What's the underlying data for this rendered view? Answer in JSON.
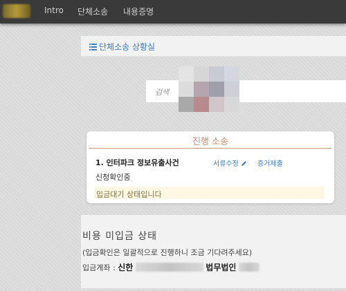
{
  "nav": {
    "items": [
      "Intro",
      "단체소송",
      "내용증명"
    ]
  },
  "header": {
    "link_label": "단체소송 상황실"
  },
  "search": {
    "label": "검색"
  },
  "mosaic_colors": [
    "#e4e4e4",
    "#d6d6d6",
    "#c9cbd2",
    "#d5d7de",
    "#dcdcdc",
    "#b5a5ad",
    "#9f9fac",
    "#cfcfd6",
    "#a9a9a9",
    "#b98a8d",
    "#cfc6c9",
    "#d8d8d8"
  ],
  "case_card": {
    "title": "진행 소송",
    "case_name": "1. 인터파크 정보유출사건",
    "edit_label": "서류수정",
    "evidence_label": "증거제출",
    "status": "신청확인중",
    "alert": "입금대기 상태입니다"
  },
  "fee": {
    "title": "비용 미입금 상태",
    "notice": "(입금확인은 일괄적으로 진행하니 조금 기다려주세요)",
    "account_label": "입금계좌 :",
    "bank": "신한",
    "holder": "법무법인"
  },
  "colors": {
    "navbar": "#3a3a3a",
    "link": "#3a7bbf",
    "card_title": "#d08a6a",
    "alert_bg": "#fcf8e3"
  }
}
